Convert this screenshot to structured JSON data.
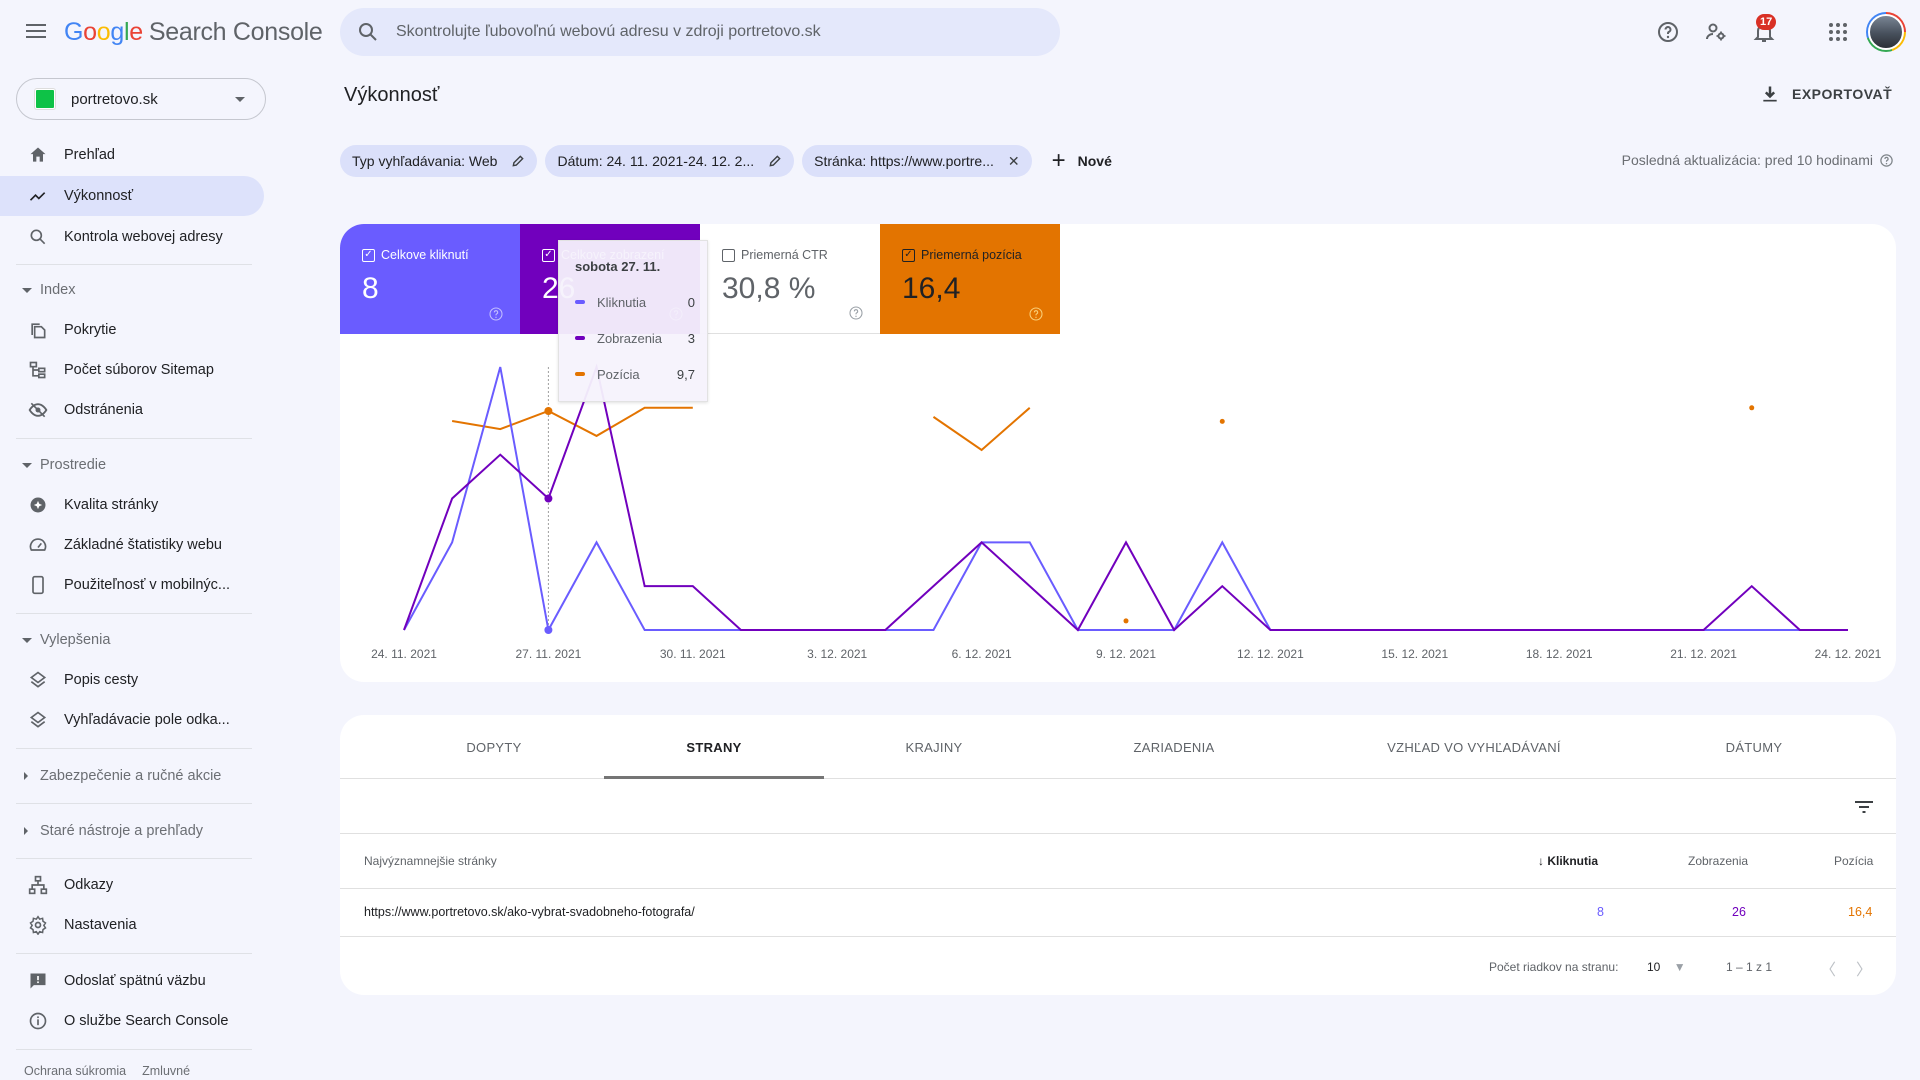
{
  "app": {
    "logo_letters": [
      "G",
      "o",
      "o",
      "g",
      "l",
      "e"
    ],
    "product": "Search Console"
  },
  "search": {
    "placeholder": "Skontrolujte ľubovoľnú webovú adresu v zdroji portretovo.sk",
    "value": ""
  },
  "top_icons": {
    "help": "help-circle-icon",
    "users": "user-settings-icon",
    "notifications": "bell-icon",
    "notification_count": "17",
    "apps": "apps-grid-icon",
    "account": "avatar"
  },
  "property": {
    "name": "portretovo.sk"
  },
  "sidebar": {
    "items": [
      {
        "label": "Prehľad",
        "icon": "home-icon"
      },
      {
        "label": "Výkonnosť",
        "icon": "trending-up-icon",
        "active": true
      },
      {
        "label": "Kontrola webovej adresy",
        "icon": "search-icon"
      }
    ],
    "sections": [
      {
        "title": "Index",
        "expanded": true,
        "items": [
          {
            "label": "Pokrytie",
            "icon": "file-copy-icon"
          },
          {
            "label": "Počet súborov Sitemap",
            "icon": "sitemap-icon"
          },
          {
            "label": "Odstránenia",
            "icon": "eye-off-icon"
          }
        ]
      },
      {
        "title": "Prostredie",
        "expanded": true,
        "items": [
          {
            "label": "Kvalita stránky",
            "icon": "page-experience-icon"
          },
          {
            "label": "Základné štatistiky webu",
            "icon": "speedometer-icon"
          },
          {
            "label": "Použiteľnosť v mobilnýc...",
            "icon": "smartphone-icon"
          }
        ]
      },
      {
        "title": "Vylepšenia",
        "expanded": true,
        "items": [
          {
            "label": "Popis cesty",
            "icon": "layers-icon"
          },
          {
            "label": "Vyhľadávacie pole odka...",
            "icon": "layers-icon"
          }
        ]
      },
      {
        "title": "Zabezpečenie a ručné akcie",
        "expanded": false,
        "items": []
      },
      {
        "title": "Staré nástroje a prehľady",
        "expanded": false,
        "items": []
      }
    ],
    "bottom_items": [
      {
        "label": "Odkazy",
        "icon": "links-icon"
      },
      {
        "label": "Nastavenia",
        "icon": "gear-icon"
      },
      {
        "label": "Odoslať spätnú väzbu",
        "icon": "feedback-icon"
      },
      {
        "label": "O službe Search Console",
        "icon": "info-icon"
      }
    ],
    "footer_links": [
      "Ochrana súkromia",
      "Zmluvné"
    ]
  },
  "main": {
    "title": "Výkonnosť",
    "export_label": "EXPORTOVAŤ",
    "filters": [
      {
        "label": "Typ vyhľadávania: Web",
        "action": "edit"
      },
      {
        "label": "Dátum: 24. 11. 2021-24. 12. 2...",
        "action": "edit"
      },
      {
        "label": "Stránka: https://www.portre...",
        "action": "remove"
      }
    ],
    "add_filter_label": "Nové",
    "last_update": "Posledná aktualizácia: pred 10 hodinami"
  },
  "metrics": [
    {
      "label": "Celkove kliknutí",
      "value": "8",
      "checked": true,
      "color": "#6a5cff"
    },
    {
      "label": "Celkove zobrazení",
      "value": "26",
      "checked": true,
      "color": "#7100bd"
    },
    {
      "label": "Priemerná CTR",
      "value": "30,8 %",
      "checked": false,
      "color": "#00897b"
    },
    {
      "label": "Priemerná pozícia",
      "value": "16,4",
      "checked": true,
      "color": "#e37400"
    }
  ],
  "tooltip": {
    "date": "sobota 27. 11.",
    "rows": [
      {
        "label": "Kliknutia",
        "value": "0",
        "color": "#6a5cff"
      },
      {
        "label": "Zobrazenia",
        "value": "3",
        "color": "#7100bd"
      },
      {
        "label": "Pozícia",
        "value": "9,7",
        "color": "#e37400"
      }
    ]
  },
  "chart_data": {
    "type": "line",
    "title": "",
    "x": [
      "24.11",
      "25.11",
      "26.11",
      "27.11",
      "28.11",
      "29.11",
      "30.11",
      "1.12",
      "2.12",
      "3.12",
      "4.12",
      "5.12",
      "6.12",
      "7.12",
      "8.12",
      "9.12",
      "10.12",
      "11.12",
      "12.12",
      "13.12",
      "14.12",
      "15.12",
      "16.12",
      "17.12",
      "18.12",
      "19.12",
      "20.12",
      "21.12",
      "22.12",
      "23.12",
      "24.12"
    ],
    "x_tick_labels": [
      "24. 11. 2021",
      "27. 11. 2021",
      "30. 11. 2021",
      "3. 12. 2021",
      "6. 12. 2021",
      "9. 12. 2021",
      "12. 12. 2021",
      "15. 12. 2021",
      "18. 12. 2021",
      "21. 12. 2021",
      "24. 12. 2021"
    ],
    "x_tick_indices": [
      0,
      3,
      6,
      9,
      12,
      15,
      18,
      21,
      24,
      27,
      30
    ],
    "series": [
      {
        "name": "Kliknutia",
        "color": "#6a5cff",
        "axis": "clicks",
        "ylim": [
          0,
          3
        ],
        "values": [
          0,
          1,
          3,
          0,
          1,
          0,
          0,
          0,
          0,
          0,
          0,
          0,
          1,
          1,
          0,
          0,
          0,
          1,
          0,
          0,
          0,
          0,
          0,
          0,
          0,
          0,
          0,
          0,
          0,
          0,
          0
        ]
      },
      {
        "name": "Zobrazenia",
        "color": "#7100bd",
        "axis": "impressions",
        "ylim": [
          0,
          6
        ],
        "values": [
          0,
          3,
          4,
          3,
          6,
          1,
          1,
          0,
          0,
          0,
          0,
          1,
          2,
          1,
          0,
          2,
          0,
          1,
          0,
          0,
          0,
          0,
          0,
          0,
          0,
          0,
          0,
          0,
          1,
          0,
          0
        ]
      },
      {
        "name": "Pozícia",
        "color": "#e37400",
        "axis": "position",
        "inverted": true,
        "ylim": [
          0,
          58
        ],
        "values": [
          null,
          11.9,
          13.7,
          9.7,
          15.2,
          9,
          9,
          null,
          null,
          null,
          null,
          11,
          18.3,
          9,
          null,
          56,
          null,
          12,
          null,
          null,
          null,
          null,
          null,
          null,
          null,
          null,
          null,
          null,
          9,
          null,
          null
        ]
      }
    ],
    "highlight_index": 3,
    "grid": false,
    "legend": "none"
  },
  "table": {
    "tabs": [
      "DOPYTY",
      "STRANY",
      "KRAJINY",
      "ZARIADENIA",
      "VZHĽAD VO VYHĽADÁVANÍ",
      "DÁTUMY"
    ],
    "active_tab": 1,
    "columns": [
      "Najvýznamnejšie stránky",
      "Kliknutia",
      "Zobrazenia",
      "Pozícia"
    ],
    "sorted_column": 1,
    "rows": [
      {
        "page": "https://www.portretovo.sk/ako-vybrat-svadobneho-fotografa/",
        "clicks": "8",
        "impressions": "26",
        "position": "16,4"
      }
    ],
    "rows_per_page_label": "Počet riadkov na stranu:",
    "rows_per_page": "10",
    "range": "1 – 1 z 1"
  }
}
